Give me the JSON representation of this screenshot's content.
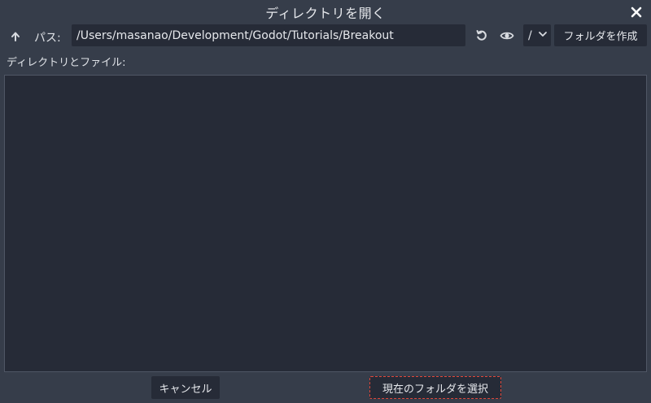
{
  "window": {
    "title": "ディレクトリを開く"
  },
  "toolbar": {
    "path_label": "パス:",
    "path_value": "/Users/masanao/Development/Godot/Tutorials/Breakout",
    "drive_value": "/",
    "mkdir_label": "フォルダを作成"
  },
  "browser": {
    "files_label": "ディレクトリとファイル:",
    "items": []
  },
  "footer": {
    "cancel_label": "キャンセル",
    "select_label": "現在のフォルダを選択"
  },
  "icons": {
    "close": "close-icon",
    "up": "arrow-up-icon",
    "refresh": "refresh-icon",
    "hidden": "eye-icon",
    "dropdown": "chevron-down-icon"
  },
  "colors": {
    "background": "#363d4a",
    "panel": "#262b37",
    "focus_outline": "#e0473a",
    "text": "#e0e3e8"
  }
}
